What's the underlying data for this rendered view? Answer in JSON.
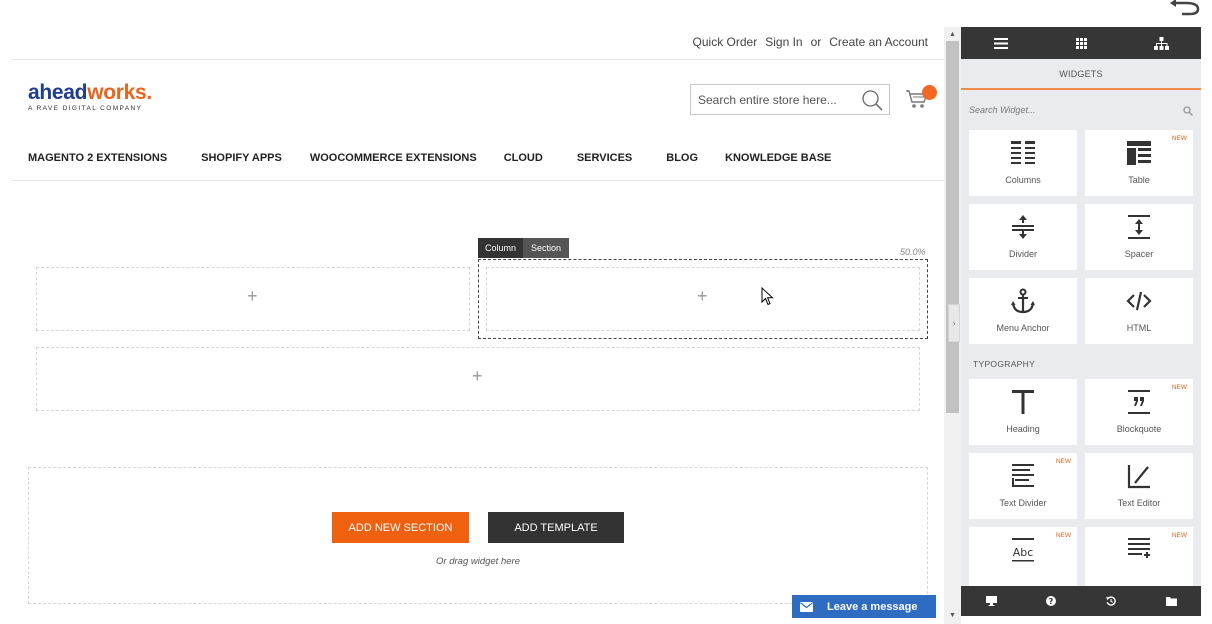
{
  "header": {
    "links": [
      "Quick Order",
      "Sign In",
      "or",
      "Create an Account"
    ],
    "logo_part1": "ahead",
    "logo_part2": "works.",
    "logo_tagline": "A RAVE DIGITAL COMPANY",
    "search_placeholder": "Search entire store here..."
  },
  "nav": {
    "items": [
      "MAGENTO 2 EXTENSIONS",
      "SHOPIFY APPS",
      "WOOCOMMERCE EXTENSIONS",
      "CLOUD",
      "SERVICES",
      "BLOG",
      "KNOWLEDGE BASE"
    ]
  },
  "builder": {
    "plus": "+",
    "column_tab": "Column",
    "section_tab": "Section",
    "column_width": "50.0%",
    "add_section_label": "ADD NEW SECTION",
    "add_template_label": "ADD TEMPLATE",
    "drag_hint": "Or drag widget here",
    "message_button": "Leave a message"
  },
  "panel": {
    "title": "WIDGETS",
    "search_placeholder": "Search Widget...",
    "top_icons": [
      "menu-icon",
      "grid-icon",
      "sitemap-icon"
    ],
    "bottom_icons": [
      "desktop-icon",
      "help-icon",
      "history-icon",
      "folder-icon"
    ],
    "new_badge": "NEW",
    "layout_widgets": [
      {
        "label": "Columns",
        "icon": "columns-icon",
        "new": false
      },
      {
        "label": "Table",
        "icon": "table-icon",
        "new": true
      },
      {
        "label": "Divider",
        "icon": "divider-icon",
        "new": false
      },
      {
        "label": "Spacer",
        "icon": "spacer-icon",
        "new": false
      },
      {
        "label": "Menu Anchor",
        "icon": "anchor-icon",
        "new": false
      },
      {
        "label": "HTML",
        "icon": "code-icon",
        "new": false
      }
    ],
    "typography_title": "TYPOGRAPHY",
    "typography_widgets": [
      {
        "label": "Heading",
        "icon": "heading-icon",
        "new": false
      },
      {
        "label": "Blockquote",
        "icon": "blockquote-icon",
        "new": true
      },
      {
        "label": "Text Divider",
        "icon": "text-divider-icon",
        "new": true
      },
      {
        "label": "Text Editor",
        "icon": "text-editor-icon",
        "new": false
      },
      {
        "label": "",
        "icon": "text-abc-icon",
        "new": true
      },
      {
        "label": "",
        "icon": "list-plus-icon",
        "new": true
      }
    ]
  },
  "colors": {
    "accent": "#f0610f",
    "panel_dark": "#363636",
    "message_blue": "#2d6cc0"
  }
}
